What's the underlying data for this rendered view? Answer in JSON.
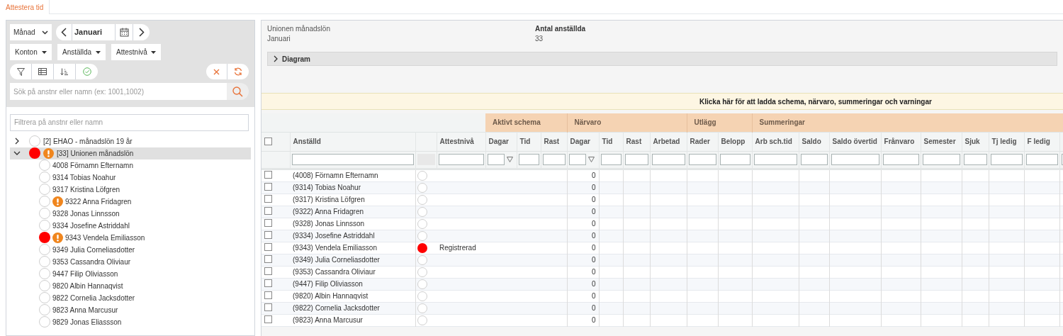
{
  "tabs": [
    {
      "label": "Attestera tid",
      "selected": true
    }
  ],
  "toolbar": {
    "period_type": "Månad",
    "period": "Januari",
    "filters": [
      "Konton",
      "Anställda",
      "Attestnivå"
    ]
  },
  "search": {
    "placeholder": "Sök på anstnr eller namn (ex: 1001,1002)"
  },
  "tree": {
    "filter_placeholder": "Filtrera på anstnr eller namn",
    "groups": [
      {
        "label": "[2]  EHAO - månadslön 19 år",
        "expanded": false,
        "selected": false,
        "registered": false,
        "warning": false
      },
      {
        "label": "[33]  Unionen månadslön",
        "expanded": true,
        "selected": true,
        "registered": true,
        "warning": true,
        "children": [
          {
            "label": "4008 Förnamn Efternamn",
            "selected": false,
            "registered": false,
            "warning": false
          },
          {
            "label": "9314 Tobias Noahur",
            "selected": false,
            "registered": false,
            "warning": false
          },
          {
            "label": "9317 Kristina Löfgren",
            "selected": false,
            "registered": false,
            "warning": false
          },
          {
            "label": "9322 Anna Fridagren",
            "selected": false,
            "registered": false,
            "warning": true
          },
          {
            "label": "9328 Jonas Linnsson",
            "selected": false,
            "registered": false,
            "warning": false
          },
          {
            "label": "9334 Josefine Astriddahl",
            "selected": false,
            "registered": false,
            "warning": false
          },
          {
            "label": "9343 Vendela Emiliasson",
            "selected": false,
            "registered": true,
            "warning": true
          },
          {
            "label": "9349 Julia Corneliasdotter",
            "selected": false,
            "registered": false,
            "warning": false
          },
          {
            "label": "9353 Cassandra Oliviaur",
            "selected": false,
            "registered": false,
            "warning": false
          },
          {
            "label": "9447 Filip Oliviasson",
            "selected": false,
            "registered": false,
            "warning": false
          },
          {
            "label": "9820 Albin Hannaqvist",
            "selected": false,
            "registered": false,
            "warning": false
          },
          {
            "label": "9822 Cornelia Jacksdotter",
            "selected": false,
            "registered": false,
            "warning": false
          },
          {
            "label": "9823 Anna Marcusur",
            "selected": false,
            "registered": false,
            "warning": false
          },
          {
            "label": "9829 Jonas Eliassson",
            "selected": false,
            "registered": false,
            "warning": false
          }
        ]
      }
    ]
  },
  "summary": {
    "group": "Unionen månadslön",
    "period": "Januari",
    "count_label": "Antal anställda",
    "count": "33"
  },
  "diagram": {
    "label": "Diagram",
    "expanded": false
  },
  "notice": "Klicka här för att ladda schema, närvaro, summeringar och varningar",
  "table": {
    "select_all_checked": false,
    "leading_columns": [
      {
        "label": "Anställd",
        "kind": "text"
      },
      {
        "kind": "disabled"
      },
      {
        "label": "Attestnivå",
        "kind": "text"
      }
    ],
    "column_groups": [
      {
        "label": "Aktivt schema",
        "columns": [
          {
            "label": "Dagar",
            "kind": "funnel"
          },
          {
            "label": "Tid",
            "kind": "text"
          },
          {
            "label": "Rast",
            "kind": "text"
          }
        ]
      },
      {
        "label": "Närvaro",
        "columns": [
          {
            "label": "Dagar",
            "kind": "funnel"
          },
          {
            "label": "Tid",
            "kind": "text"
          },
          {
            "label": "Rast",
            "kind": "text"
          },
          {
            "label": "Arbetad",
            "kind": "text"
          }
        ]
      },
      {
        "label": "Utlägg",
        "columns": [
          {
            "label": "Rader",
            "kind": "text"
          },
          {
            "label": "Belopp",
            "kind": "text"
          }
        ]
      },
      {
        "label": "Summeringar",
        "columns": [
          {
            "label": "Arb sch.tid",
            "kind": "text"
          },
          {
            "label": "Saldo",
            "kind": "text"
          },
          {
            "label": "Saldo övertid",
            "kind": "text"
          },
          {
            "label": "Frånvaro",
            "kind": "text"
          },
          {
            "label": "Semester",
            "kind": "text"
          },
          {
            "label": "Sjuk",
            "kind": "text"
          },
          {
            "label": "Tj ledig",
            "kind": "text"
          },
          {
            "label": "F ledig",
            "kind": "text"
          },
          {
            "kind": "text"
          }
        ]
      }
    ],
    "rows": [
      {
        "checked": false,
        "employee": "(4008) Förnamn Efternamn",
        "registered": false,
        "presence_days": "0"
      },
      {
        "checked": false,
        "employee": "(9314) Tobias Noahur",
        "registered": false,
        "presence_days": "0"
      },
      {
        "checked": false,
        "employee": "(9317) Kristina Löfgren",
        "registered": false,
        "presence_days": "0"
      },
      {
        "checked": false,
        "employee": "(9322) Anna Fridagren",
        "registered": false,
        "presence_days": "0"
      },
      {
        "checked": false,
        "employee": "(9328) Jonas Linnsson",
        "registered": false,
        "presence_days": "0"
      },
      {
        "checked": false,
        "employee": "(9334) Josefine Astriddahl",
        "registered": false,
        "presence_days": "0"
      },
      {
        "checked": false,
        "employee": "(9343) Vendela Emiliasson",
        "registered": true,
        "attest_level": "Registrerad",
        "presence_days": "0"
      },
      {
        "checked": false,
        "employee": "(9349) Julia Corneliasdotter",
        "registered": false,
        "presence_days": "0"
      },
      {
        "checked": false,
        "employee": "(9353) Cassandra Oliviaur",
        "registered": false,
        "presence_days": "0"
      },
      {
        "checked": false,
        "employee": "(9447) Filip Oliviasson",
        "registered": false,
        "presence_days": "0"
      },
      {
        "checked": false,
        "employee": "(9820) Albin Hannaqvist",
        "registered": false,
        "presence_days": "0"
      },
      {
        "checked": false,
        "employee": "(9822) Cornelia Jacksdotter",
        "registered": false,
        "presence_days": "0"
      },
      {
        "checked": false,
        "employee": "(9823) Anna Marcusur",
        "registered": false,
        "presence_days": "0"
      }
    ]
  }
}
